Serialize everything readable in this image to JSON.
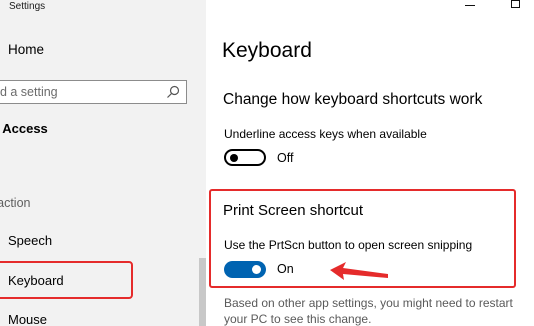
{
  "window": {
    "title": "Settings",
    "controls": {
      "minimize_icon": "minimize-icon",
      "maximize_icon": "maximize-icon"
    }
  },
  "sidebar": {
    "home_label": "Home",
    "search": {
      "placeholder": "nd a setting",
      "icon": "search-icon"
    },
    "section_title": "e of Access",
    "group_label": "eraction",
    "items": [
      {
        "label": "Speech"
      },
      {
        "label": "Keyboard",
        "selected": true
      },
      {
        "label": "Mouse"
      }
    ]
  },
  "main": {
    "title": "Keyboard",
    "subheading": "Change how keyboard shortcuts work",
    "underline_access_keys": {
      "label": "Underline access keys when available",
      "state": "Off"
    },
    "print_screen": {
      "heading": "Print Screen shortcut",
      "label": "Use the PrtScn button to open screen snipping",
      "state": "On",
      "info": "Based on other app settings, you might need to restart your PC to see this change."
    }
  },
  "colors": {
    "sidebar_bg": "#f2f2f2",
    "accent": "#0063b1",
    "annotation": "#e52b2b"
  }
}
